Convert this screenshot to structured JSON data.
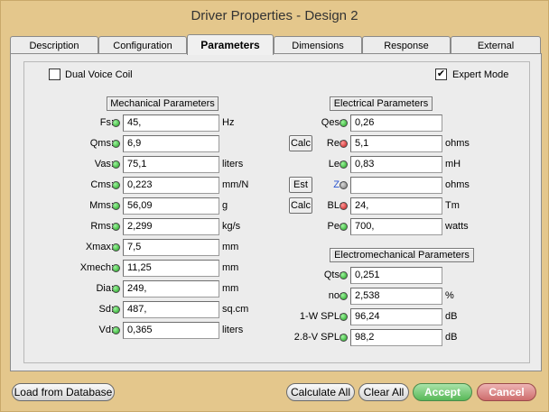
{
  "window": {
    "title": "Driver Properties - Design 2"
  },
  "tabs": [
    "Description",
    "Configuration",
    "Parameters",
    "Dimensions",
    "Response",
    "External"
  ],
  "active_tab": "Parameters",
  "options": {
    "dual_voice_coil": {
      "label": "Dual Voice Coil",
      "checked": false,
      "mark": ""
    },
    "expert_mode": {
      "label": "Expert Mode",
      "checked": true,
      "mark": "✔"
    }
  },
  "mechanical": {
    "header": "Mechanical Parameters",
    "rows": [
      {
        "label": "Fs:",
        "value": "45,",
        "unit": "Hz"
      },
      {
        "label": "Qms:",
        "value": "6,9",
        "unit": ""
      },
      {
        "label": "Vas:",
        "value": "75,1",
        "unit": "liters"
      },
      {
        "label": "Cms:",
        "value": "0,223",
        "unit": "mm/N"
      },
      {
        "label": "Mms:",
        "value": "56,09",
        "unit": "g"
      },
      {
        "label": "Rms:",
        "value": "2,299",
        "unit": "kg/s"
      },
      {
        "label": "Xmax:",
        "value": "7,5",
        "unit": "mm"
      },
      {
        "label": "Xmech:",
        "value": "11,25",
        "unit": "mm"
      },
      {
        "label": "Dia:",
        "value": "249,",
        "unit": "mm"
      },
      {
        "label": "Sd:",
        "value": "487,",
        "unit": "sq.cm"
      },
      {
        "label": "Vd:",
        "value": "0,365",
        "unit": "liters"
      }
    ]
  },
  "electrical": {
    "header": "Electrical Parameters",
    "rows": [
      {
        "label": "Qes:",
        "value": "0,26",
        "unit": "",
        "button": ""
      },
      {
        "label": "Re:",
        "value": "5,1",
        "unit": "ohms",
        "button": "Calc"
      },
      {
        "label": "Le:",
        "value": "0,83",
        "unit": "mH",
        "button": ""
      },
      {
        "label": "Z:",
        "value": "",
        "unit": "ohms",
        "button": "Est"
      },
      {
        "label": "BL:",
        "value": "24,",
        "unit": "Tm",
        "button": "Calc"
      },
      {
        "label": "Pe:",
        "value": "700,",
        "unit": "watts",
        "button": ""
      }
    ]
  },
  "electromechanical": {
    "header": "Electromechanical Parameters",
    "rows": [
      {
        "label": "Qts:",
        "value": "0,251",
        "unit": ""
      },
      {
        "label": "no:",
        "value": "2,538",
        "unit": "%"
      },
      {
        "label": "1-W SPL:",
        "value": "96,24",
        "unit": "dB"
      },
      {
        "label": "2.8-V SPL:",
        "value": "98,2",
        "unit": "dB"
      }
    ]
  },
  "buttons": {
    "load": "Load from Database",
    "calculate_all": "Calculate All",
    "clear_all": "Clear All",
    "accept": "Accept",
    "cancel": "Cancel"
  }
}
